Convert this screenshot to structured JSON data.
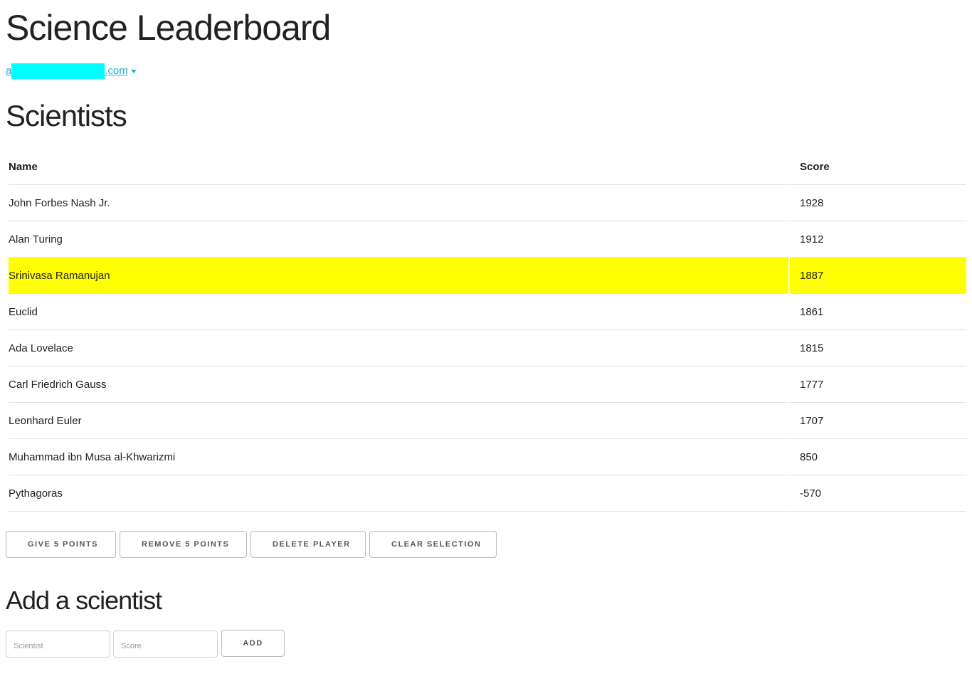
{
  "header": {
    "title": "Science Leaderboard",
    "account_prefix": "a",
    "account_suffix": ".com"
  },
  "scientists": {
    "heading": "Scientists",
    "columns": {
      "name": "Name",
      "score": "Score"
    },
    "rows": [
      {
        "name": "John Forbes Nash Jr.",
        "score": "1928"
      },
      {
        "name": "Alan Turing",
        "score": "1912"
      },
      {
        "name": "Srinivasa Ramanujan",
        "score": "1887",
        "selected": true
      },
      {
        "name": "Euclid",
        "score": "1861"
      },
      {
        "name": "Ada Lovelace",
        "score": "1815"
      },
      {
        "name": "Carl Friedrich Gauss",
        "score": "1777"
      },
      {
        "name": "Leonhard Euler",
        "score": "1707"
      },
      {
        "name": "Muhammad ibn Musa al-Khwarizmi",
        "score": "850"
      },
      {
        "name": "Pythagoras",
        "score": "-570"
      }
    ]
  },
  "actions": {
    "give": "GIVE 5 POINTS",
    "remove": "REMOVE 5 POINTS",
    "delete": "DELETE PLAYER",
    "clear": "CLEAR SELECTION"
  },
  "add_form": {
    "heading": "Add a scientist",
    "scientist_placeholder": "Scientist",
    "score_placeholder": "Score",
    "add_label": "ADD"
  },
  "colors": {
    "link": "#1EAEDB",
    "selected_row": "#ffff00",
    "redaction": "#00ffff"
  }
}
